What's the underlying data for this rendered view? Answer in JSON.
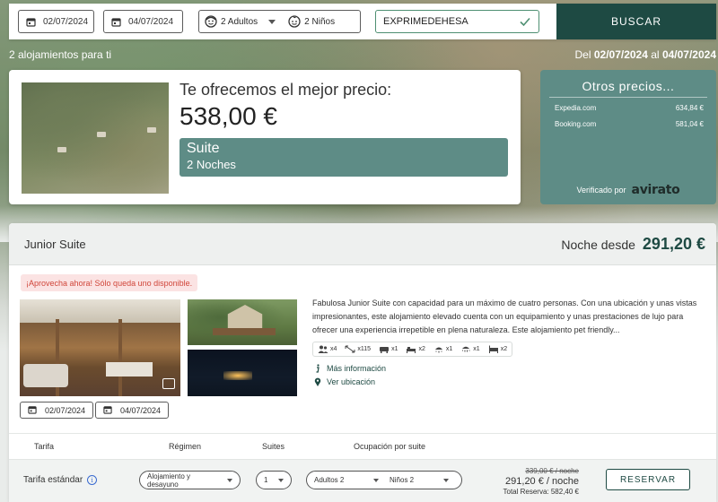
{
  "search": {
    "checkin": "02/07/2024",
    "checkout": "04/07/2024",
    "adults": "2 Adultos",
    "children": "2 Niños",
    "promo_code": "EXPRIMEDEHESA",
    "search_label": "BUSCAR"
  },
  "results": {
    "count_text": "2 alojamientos para ti",
    "range_prefix": "Del",
    "range_from": "02/07/2024",
    "range_mid": "al",
    "range_to": "04/07/2024"
  },
  "best_price": {
    "heading": "Te ofrecemos el mejor precio:",
    "price": "538,00 €",
    "room": "Suite",
    "nights": "2 Noches"
  },
  "other_prices": {
    "title": "Otros precios...",
    "rows": [
      {
        "site": "Expedia.com",
        "price": "634,84 €"
      },
      {
        "site": "Booking.com",
        "price": "581,04 €"
      }
    ],
    "verified_label": "Verificado por",
    "verified_brand": "avirato"
  },
  "room": {
    "title": "Junior Suite",
    "price_from_label": "Noche desde",
    "price_from_value": "291,20 €",
    "alert": "¡Aprovecha ahora! Sólo queda uno disponible.",
    "checkin": "02/07/2024",
    "checkout": "04/07/2024",
    "description": "Fabulosa Junior Suite con capacidad para un máximo de cuatro personas. Con una ubicación y unas vistas impresionantes, este alojamiento elevado cuenta con un equipamiento y unas prestaciones de lujo para ofrecer una experiencia irrepetible en plena naturaleza.  Este alojamiento pet friendly...",
    "amenities": [
      {
        "icon": "guests-icon",
        "label": "x4"
      },
      {
        "icon": "area-icon",
        "label": "x115"
      },
      {
        "icon": "sofa-icon",
        "label": "x1"
      },
      {
        "icon": "bed-icon",
        "label": "x2"
      },
      {
        "icon": "shower-icon",
        "label": "x1"
      },
      {
        "icon": "bath-icon",
        "label": "x1"
      },
      {
        "icon": "double-bed-icon",
        "label": "x2"
      }
    ],
    "more_info": "Más información",
    "location": "Ver ubicación"
  },
  "rates": {
    "headers": {
      "rate": "Tarifa",
      "board": "Régimen",
      "suites": "Suites",
      "occupancy": "Ocupación por suite"
    },
    "row": {
      "name": "Tarifa estándar",
      "board": "Alojamiento y desayuno",
      "suites": "1",
      "adults": "Adultos 2",
      "children": "Niños 2",
      "old_price": "339,00 € / noche",
      "night_price": "291,20 € / noche",
      "total": "Total Reserva: 582,40 €",
      "book_label": "RESERVAR"
    }
  },
  "colors": {
    "accent_dark": "#1e4a43",
    "accent_teal": "#5e8c86",
    "alert_bg": "#fbe3e3",
    "alert_text": "#d0463a",
    "promo_valid": "#4e8f72"
  }
}
